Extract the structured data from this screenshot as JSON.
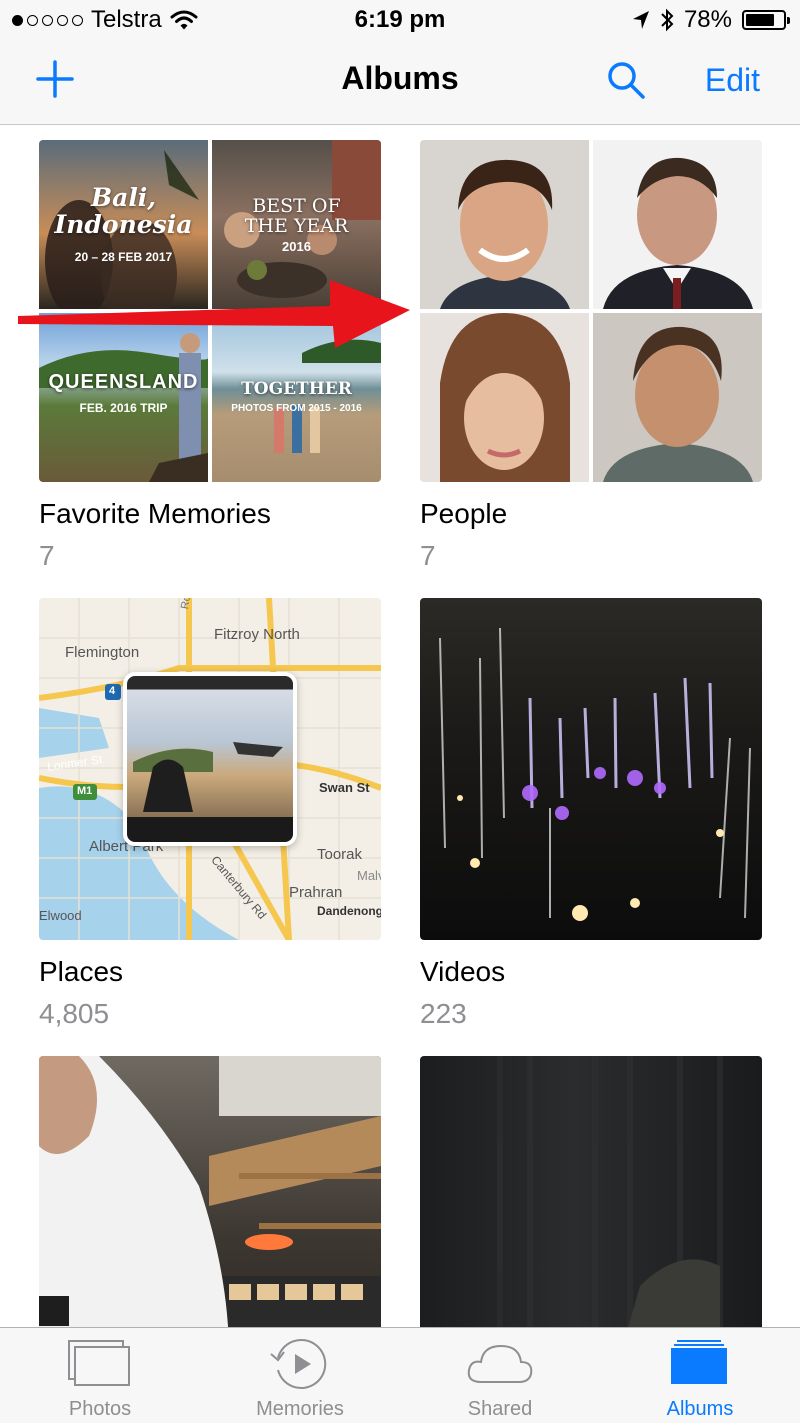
{
  "status": {
    "carrier": "Telstra",
    "time": "6:19 pm",
    "battery": "78%",
    "battery_level": 0.78,
    "signal_bars": 1
  },
  "nav": {
    "title": "Albums",
    "edit_label": "Edit"
  },
  "albums": [
    {
      "title": "Favorite Memories",
      "count": "7",
      "memories": [
        {
          "line1": "Bali,",
          "line2": "Indonesia",
          "sub": "20 – 28 FEB 2017"
        },
        {
          "line1": "BEST OF",
          "line2": "THE YEAR",
          "sub": "2016"
        },
        {
          "line1": "QUEENSLAND",
          "sub": "FEB. 2016 TRIP"
        },
        {
          "line1": "TOGETHER",
          "sub": "PHOTOS FROM 2015 - 2016"
        }
      ]
    },
    {
      "title": "People",
      "count": "7"
    },
    {
      "title": "Places",
      "count": "4,805",
      "map_labels": {
        "fitzroy": "Fitzroy North",
        "flemington": "Flemington",
        "lorimer": "Lorimer St",
        "m1": "M1",
        "swan": "Swan St",
        "toorak": "Toorak",
        "prahran": "Prahran",
        "dandenong": "Dandenong",
        "albert": "Albert Park",
        "canterbury": "Canterbury Rd",
        "royal": "Royal Parade",
        "malvern": "Malvern",
        "route": "4",
        "elwood": "Elwood"
      }
    },
    {
      "title": "Videos",
      "count": "223"
    },
    {
      "title": ""
    },
    {
      "title": ""
    }
  ],
  "tabs": [
    {
      "label": "Photos",
      "icon": "photos-tab-icon"
    },
    {
      "label": "Memories",
      "icon": "memories-tab-icon"
    },
    {
      "label": "Shared",
      "icon": "shared-cloud-icon"
    },
    {
      "label": "Albums",
      "icon": "albums-tab-icon",
      "active": true
    }
  ],
  "colors": {
    "accent": "#0a7aff",
    "annotation_arrow": "#e8141c",
    "count_gray": "#8e8e93"
  }
}
